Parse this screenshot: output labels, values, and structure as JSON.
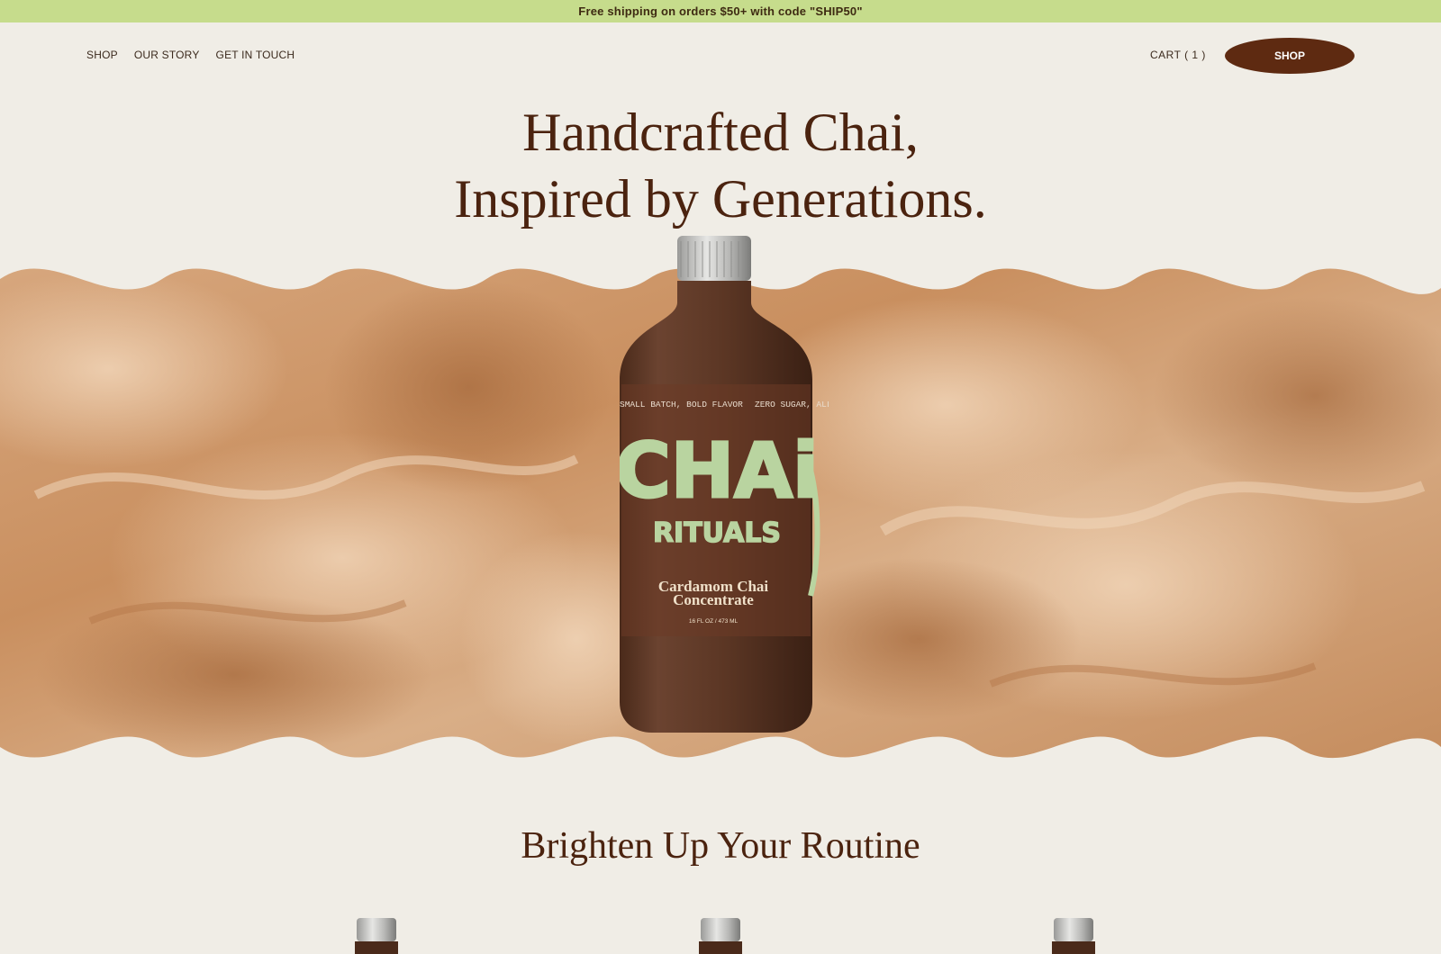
{
  "announcement": {
    "text": "Free shipping on orders $50+ with code \"SHIP50\""
  },
  "nav": {
    "links": [
      "SHOP",
      "OUR STORY",
      "GET IN TOUCH"
    ],
    "cart_label": "CART ( 1 )",
    "shop_button": "SHOP"
  },
  "hero": {
    "title_line1": "Handcrafted Chai,",
    "title_line2": "Inspired by Generations."
  },
  "product": {
    "tagline_left": "SMALL BATCH, BOLD FLAVOR",
    "tagline_right": "ZERO SUGAR, ALL",
    "brand_top": "CHAi",
    "brand_bottom": "RITUALS",
    "name_line1": "Cardamom Chai",
    "name_line2": "Concentrate",
    "volume": "16 FL OZ / 473 ML"
  },
  "section": {
    "title": "Brighten Up Your Routine"
  },
  "colors": {
    "announcement_bg": "#c6dc8c",
    "page_bg": "#f0ede6",
    "brand_brown": "#5e2a11",
    "label_green": "#b9d4a0"
  }
}
